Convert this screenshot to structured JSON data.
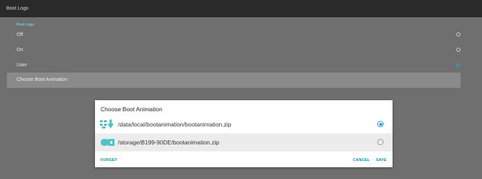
{
  "window": {
    "title": "Boot Logo"
  },
  "settings": {
    "section_label": "Boot Logo",
    "options": [
      {
        "label": "Off",
        "selected": false
      },
      {
        "label": "On",
        "selected": false
      },
      {
        "label": "User",
        "selected": true
      }
    ],
    "choose_label": "Choose Boot Animation"
  },
  "dialog": {
    "title": "Choose Boot Animation",
    "items": [
      {
        "path": "/data/local/bootanimation/bootanimation.zip",
        "icon": "internal-storage-icon",
        "selected": true
      },
      {
        "path": "/storage/B199-90DE/bootanimation.zip",
        "icon": "usb-drive-icon",
        "selected": false
      }
    ],
    "buttons": {
      "forget": "FORGET",
      "cancel": "CANCEL",
      "save": "SAVE"
    }
  },
  "colors": {
    "accent_teal": "#0e8f96",
    "radio_blue": "#2196f3",
    "section_label": "#7fe3ea"
  }
}
